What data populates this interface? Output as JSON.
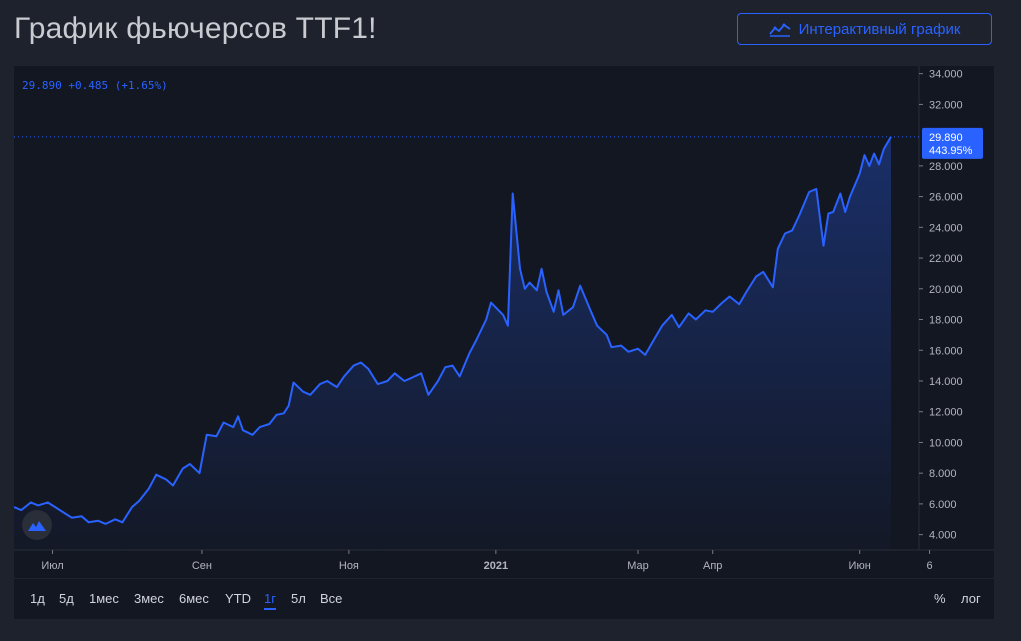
{
  "header": {
    "title": "График фьючерсов TTF1!",
    "interactive_button_label": "Интерактивный график"
  },
  "legend": {
    "price": "29.890",
    "change": "+0.485",
    "change_pct": "(+1.65%)"
  },
  "last_price_label": {
    "price": "29.890",
    "percent": "443.95%"
  },
  "range_buttons": [
    "1д",
    "5д",
    "1мес",
    "3мес",
    "6мес",
    "YTD",
    "1г",
    "5л",
    "Все"
  ],
  "active_range": "1г",
  "scale_buttons": [
    "%",
    "лог"
  ],
  "colors": {
    "background": "#131722",
    "line": "#2962ff",
    "accent": "#2962ff",
    "axis_text": "#b2b5be"
  },
  "chart_data": {
    "type": "area",
    "title": "",
    "xlabel": "",
    "ylabel": "",
    "ylim": [
      3.0,
      34.5
    ],
    "x_tick_labels": [
      "Июл",
      "Сен",
      "Ноя",
      "2021",
      "Мар",
      "Апр",
      "Июн",
      "6"
    ],
    "y_ticks": [
      "4.000",
      "6.000",
      "8.000",
      "10.000",
      "12.000",
      "14.000",
      "16.000",
      "18.000",
      "20.000",
      "22.000",
      "24.000",
      "26.000",
      "28.000",
      "32.000",
      "34.000"
    ],
    "series": [
      {
        "points": [
          [
            "2020-06-15",
            5.8
          ],
          [
            "2020-06-18",
            5.6
          ],
          [
            "2020-06-22",
            6.1
          ],
          [
            "2020-06-25",
            5.9
          ],
          [
            "2020-06-29",
            6.1
          ],
          [
            "2020-07-02",
            5.8
          ],
          [
            "2020-07-06",
            5.4
          ],
          [
            "2020-07-09",
            5.1
          ],
          [
            "2020-07-13",
            5.2
          ],
          [
            "2020-07-16",
            4.8
          ],
          [
            "2020-07-20",
            4.9
          ],
          [
            "2020-07-23",
            4.7
          ],
          [
            "2020-07-27",
            5.0
          ],
          [
            "2020-07-30",
            4.8
          ],
          [
            "2020-08-03",
            5.8
          ],
          [
            "2020-08-06",
            6.2
          ],
          [
            "2020-08-10",
            7.0
          ],
          [
            "2020-08-13",
            7.9
          ],
          [
            "2020-08-17",
            7.6
          ],
          [
            "2020-08-20",
            7.2
          ],
          [
            "2020-08-24",
            8.3
          ],
          [
            "2020-08-27",
            8.6
          ],
          [
            "2020-08-31",
            8.0
          ],
          [
            "2020-09-03",
            10.5
          ],
          [
            "2020-09-07",
            10.4
          ],
          [
            "2020-09-10",
            11.3
          ],
          [
            "2020-09-14",
            11.0
          ],
          [
            "2020-09-16",
            11.7
          ],
          [
            "2020-09-18",
            10.8
          ],
          [
            "2020-09-22",
            10.5
          ],
          [
            "2020-09-25",
            11.0
          ],
          [
            "2020-09-29",
            11.2
          ],
          [
            "2020-10-02",
            11.8
          ],
          [
            "2020-10-05",
            11.9
          ],
          [
            "2020-10-07",
            12.4
          ],
          [
            "2020-10-09",
            13.9
          ],
          [
            "2020-10-13",
            13.3
          ],
          [
            "2020-10-16",
            13.1
          ],
          [
            "2020-10-20",
            13.8
          ],
          [
            "2020-10-23",
            14.0
          ],
          [
            "2020-10-27",
            13.6
          ],
          [
            "2020-10-30",
            14.3
          ],
          [
            "2020-11-03",
            15.0
          ],
          [
            "2020-11-06",
            15.2
          ],
          [
            "2020-11-09",
            14.8
          ],
          [
            "2020-11-13",
            13.8
          ],
          [
            "2020-11-17",
            14.0
          ],
          [
            "2020-11-20",
            14.5
          ],
          [
            "2020-11-24",
            14.0
          ],
          [
            "2020-11-27",
            14.2
          ],
          [
            "2020-12-01",
            14.5
          ],
          [
            "2020-12-04",
            13.1
          ],
          [
            "2020-12-08",
            14.0
          ],
          [
            "2020-12-11",
            14.9
          ],
          [
            "2020-12-14",
            15.0
          ],
          [
            "2020-12-17",
            14.3
          ],
          [
            "2020-12-21",
            15.8
          ],
          [
            "2020-12-24",
            16.7
          ],
          [
            "2020-12-28",
            18.0
          ],
          [
            "2020-12-30",
            19.1
          ],
          [
            "2021-01-04",
            18.3
          ],
          [
            "2021-01-06",
            17.6
          ],
          [
            "2021-01-08",
            26.2
          ],
          [
            "2021-01-11",
            21.3
          ],
          [
            "2021-01-13",
            20.0
          ],
          [
            "2021-01-15",
            20.4
          ],
          [
            "2021-01-18",
            19.9
          ],
          [
            "2021-01-20",
            21.3
          ],
          [
            "2021-01-22",
            19.8
          ],
          [
            "2021-01-25",
            18.5
          ],
          [
            "2021-01-27",
            19.9
          ],
          [
            "2021-01-29",
            18.3
          ],
          [
            "2021-02-02",
            18.8
          ],
          [
            "2021-02-05",
            20.2
          ],
          [
            "2021-02-09",
            18.7
          ],
          [
            "2021-02-12",
            17.6
          ],
          [
            "2021-02-16",
            17.0
          ],
          [
            "2021-02-18",
            16.2
          ],
          [
            "2021-02-22",
            16.3
          ],
          [
            "2021-02-25",
            15.9
          ],
          [
            "2021-03-01",
            16.1
          ],
          [
            "2021-03-04",
            15.7
          ],
          [
            "2021-03-08",
            16.8
          ],
          [
            "2021-03-11",
            17.6
          ],
          [
            "2021-03-15",
            18.3
          ],
          [
            "2021-03-18",
            17.5
          ],
          [
            "2021-03-22",
            18.4
          ],
          [
            "2021-03-25",
            18.0
          ],
          [
            "2021-03-29",
            18.6
          ],
          [
            "2021-04-01",
            18.5
          ],
          [
            "2021-04-05",
            19.1
          ],
          [
            "2021-04-08",
            19.5
          ],
          [
            "2021-04-12",
            19.0
          ],
          [
            "2021-04-15",
            19.8
          ],
          [
            "2021-04-19",
            20.8
          ],
          [
            "2021-04-22",
            21.1
          ],
          [
            "2021-04-26",
            20.1
          ],
          [
            "2021-04-28",
            22.6
          ],
          [
            "2021-05-01",
            23.6
          ],
          [
            "2021-05-04",
            23.8
          ],
          [
            "2021-05-07",
            24.8
          ],
          [
            "2021-05-11",
            26.3
          ],
          [
            "2021-05-14",
            26.5
          ],
          [
            "2021-05-17",
            22.8
          ],
          [
            "2021-05-19",
            24.9
          ],
          [
            "2021-05-21",
            25.0
          ],
          [
            "2021-05-24",
            26.2
          ],
          [
            "2021-05-26",
            25.0
          ],
          [
            "2021-05-28",
            26.0
          ],
          [
            "2021-06-01",
            27.5
          ],
          [
            "2021-06-03",
            28.7
          ],
          [
            "2021-06-05",
            28.0
          ],
          [
            "2021-06-07",
            28.8
          ],
          [
            "2021-06-09",
            28.1
          ],
          [
            "2021-06-11",
            29.1
          ],
          [
            "2021-06-14",
            29.89
          ]
        ]
      }
    ]
  }
}
